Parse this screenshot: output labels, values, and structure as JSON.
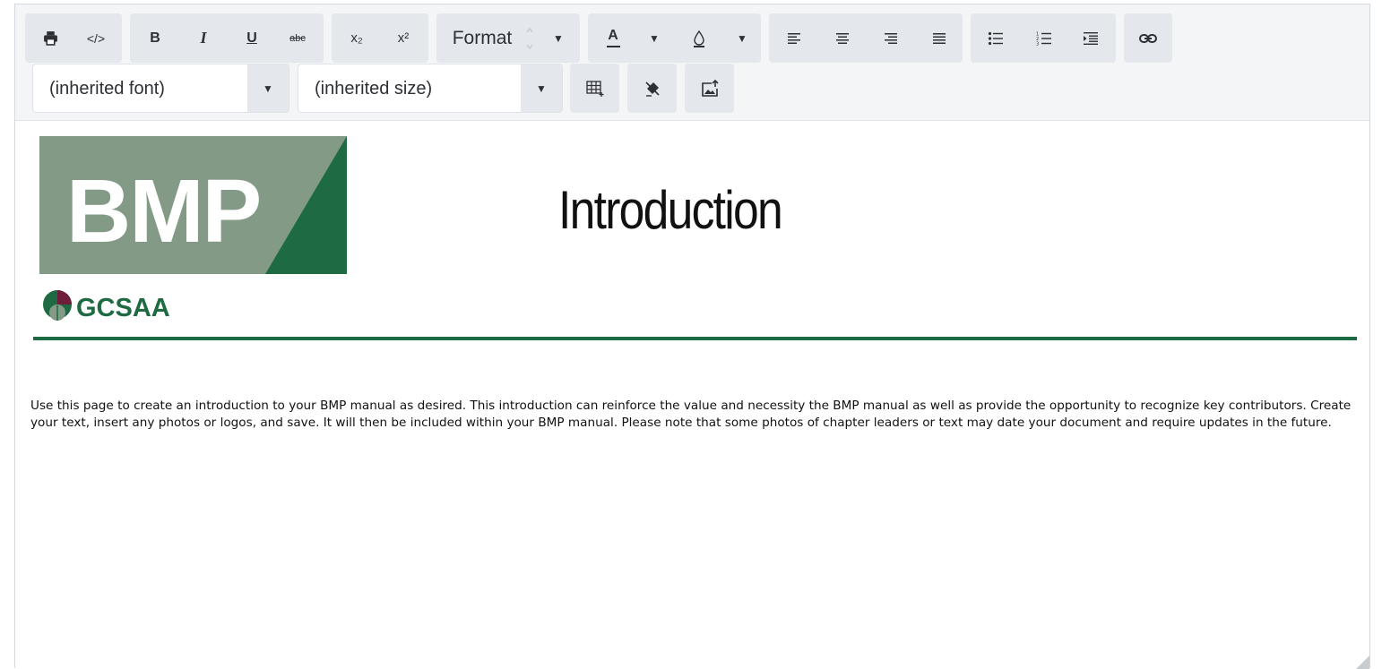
{
  "toolbar": {
    "format_label": "Format",
    "font_select": {
      "value": "(inherited font)"
    },
    "size_select": {
      "value": "(inherited size)"
    },
    "buttons": {
      "bold": "B",
      "italic": "I",
      "underline": "U",
      "strikethrough": "abc",
      "subscript": "x₂",
      "superscript": "x²",
      "view_html": "</>",
      "font_color": "A"
    },
    "icons": [
      "print-icon",
      "view-html-icon",
      "bold-icon",
      "italic-icon",
      "underline-icon",
      "strikethrough-icon",
      "subscript-icon",
      "superscript-icon",
      "font-color-icon",
      "background-color-icon",
      "align-left-icon",
      "align-center-icon",
      "align-right-icon",
      "justify-icon",
      "bulleted-list-icon",
      "numbered-list-icon",
      "indent-icon",
      "insert-link-icon",
      "create-table-icon",
      "clean-formatting-icon",
      "insert-image-icon"
    ]
  },
  "document": {
    "logo": {
      "main_text": "BMP",
      "sub_text": "GCSAA"
    },
    "title": "Introduction",
    "body": "Use this page to create an introduction to your BMP manual as desired. This introduction can reinforce the value and necessity the BMP manual as well as provide the opportunity to recognize key contributors. Create your text, insert any photos or logos, and save. It will then be included within your BMP manual. Please note that some photos of chapter leaders or text may date your document and require updates in the future."
  },
  "colors": {
    "brand_green": "#1e6b43",
    "logo_gray_green": "#839a86",
    "toolbar_bg": "#f4f5f6",
    "button_group_bg": "#e4e7eb",
    "gcsaa_maroon": "#6f1d3a"
  }
}
